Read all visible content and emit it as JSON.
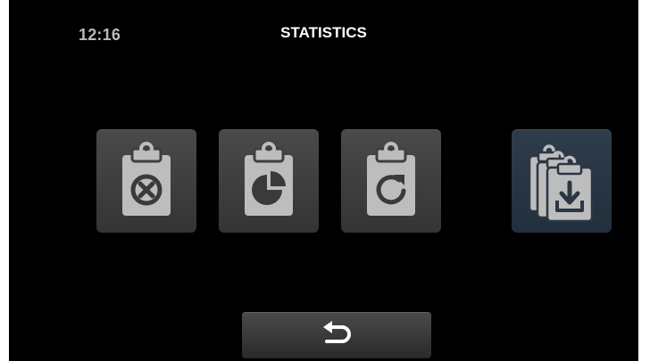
{
  "status": {
    "time": "12:16"
  },
  "header": {
    "title": "STATISTICS"
  },
  "tiles": [
    {
      "name": "clear-statistics",
      "icon": "clipboard-x-icon"
    },
    {
      "name": "view-statistics",
      "icon": "clipboard-pie-chart-icon"
    },
    {
      "name": "reset-statistics",
      "icon": "clipboard-refresh-icon"
    },
    {
      "name": "export-statistics",
      "icon": "clipboards-download-icon",
      "selected": true
    }
  ],
  "footer": {
    "back_icon": "back-arrow-icon"
  },
  "colors": {
    "background": "#000000",
    "tile": "#3e3e3e",
    "tile_selected": "#2a3744",
    "icon": "#bdbdbd",
    "text_clock": "#b9b9b9",
    "text_title": "#ffffff"
  }
}
